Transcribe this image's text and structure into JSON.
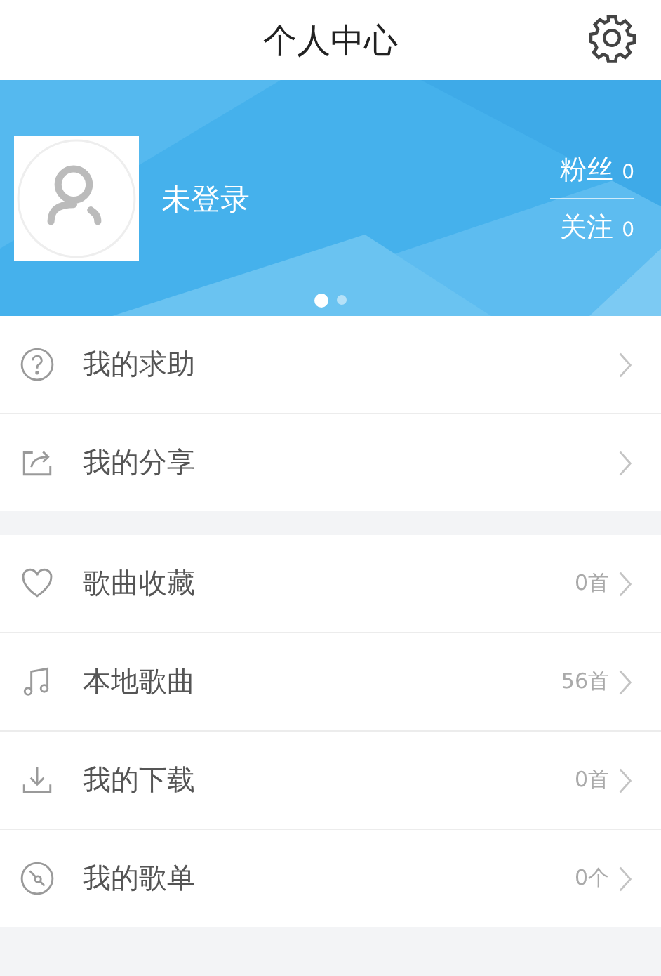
{
  "header": {
    "title": "个人中心"
  },
  "profile": {
    "name": "未登录",
    "stats": [
      {
        "label": "粉丝",
        "value": "0"
      },
      {
        "label": "关注",
        "value": "0"
      }
    ],
    "pager": [
      {
        "selected": true
      },
      {
        "selected": false
      }
    ]
  },
  "groups": [
    [
      {
        "label": "我的求助"
      },
      {
        "label": "我的分享"
      }
    ],
    [
      {
        "label": "歌曲收藏",
        "count": "0首"
      },
      {
        "label": "本地歌曲",
        "count": "56首"
      },
      {
        "label": "我的下载",
        "count": "0首"
      },
      {
        "label": "我的歌单",
        "count": "0个"
      }
    ]
  ]
}
